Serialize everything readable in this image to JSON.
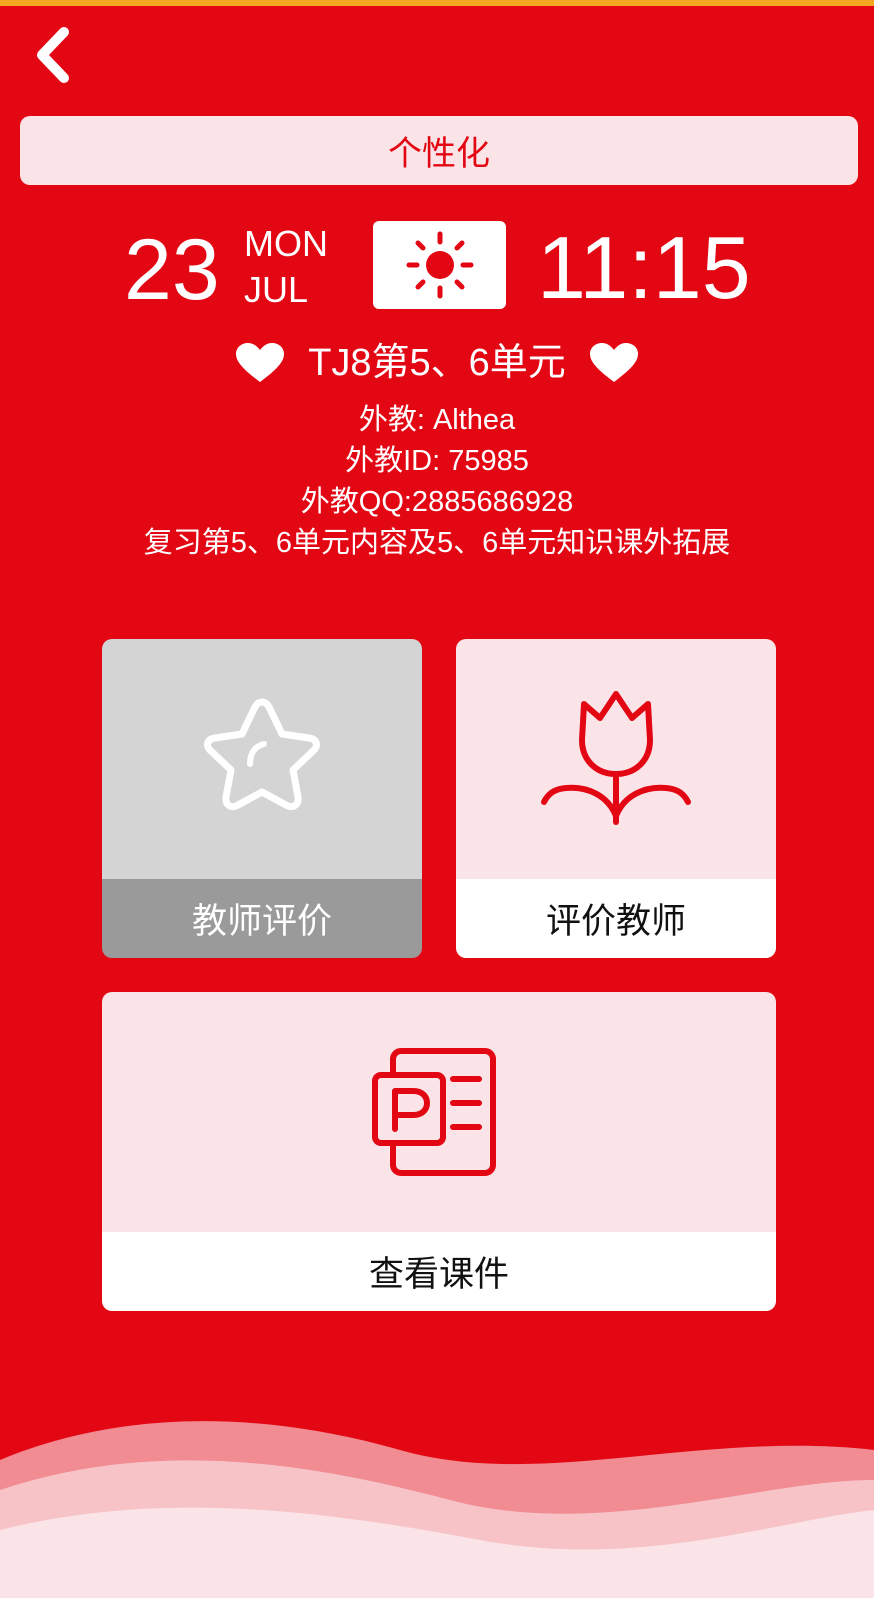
{
  "header": {
    "back_icon": "chevron-left-icon"
  },
  "category": {
    "label": "个性化"
  },
  "schedule": {
    "day": "23",
    "weekday": "MON",
    "month": "JUL",
    "weather_icon": "sun-icon",
    "time": "11:15"
  },
  "course": {
    "title": "TJ8第5、6单元",
    "decor_icon": "heart-icon",
    "teacher_line": "外教: Althea",
    "teacher_id_line": "外教ID: 75985",
    "teacher_qq_line": "外教QQ:2885686928",
    "description": "复习第5、6单元内容及5、6单元知识课外拓展"
  },
  "actions": {
    "teacher_evaluation": {
      "label": "教师评价",
      "icon": "star-icon",
      "enabled": false
    },
    "rate_teacher": {
      "label": "评价教师",
      "icon": "tulip-icon",
      "enabled": true
    },
    "view_courseware": {
      "label": "查看课件",
      "icon": "powerpoint-icon",
      "enabled": true
    }
  },
  "colors": {
    "primary_red": "#e30613",
    "light_pink": "#fbe4e8",
    "disabled_gray": "#d4d4d4",
    "disabled_label_gray": "#9a9a9a",
    "top_strip": "#f5a623"
  }
}
